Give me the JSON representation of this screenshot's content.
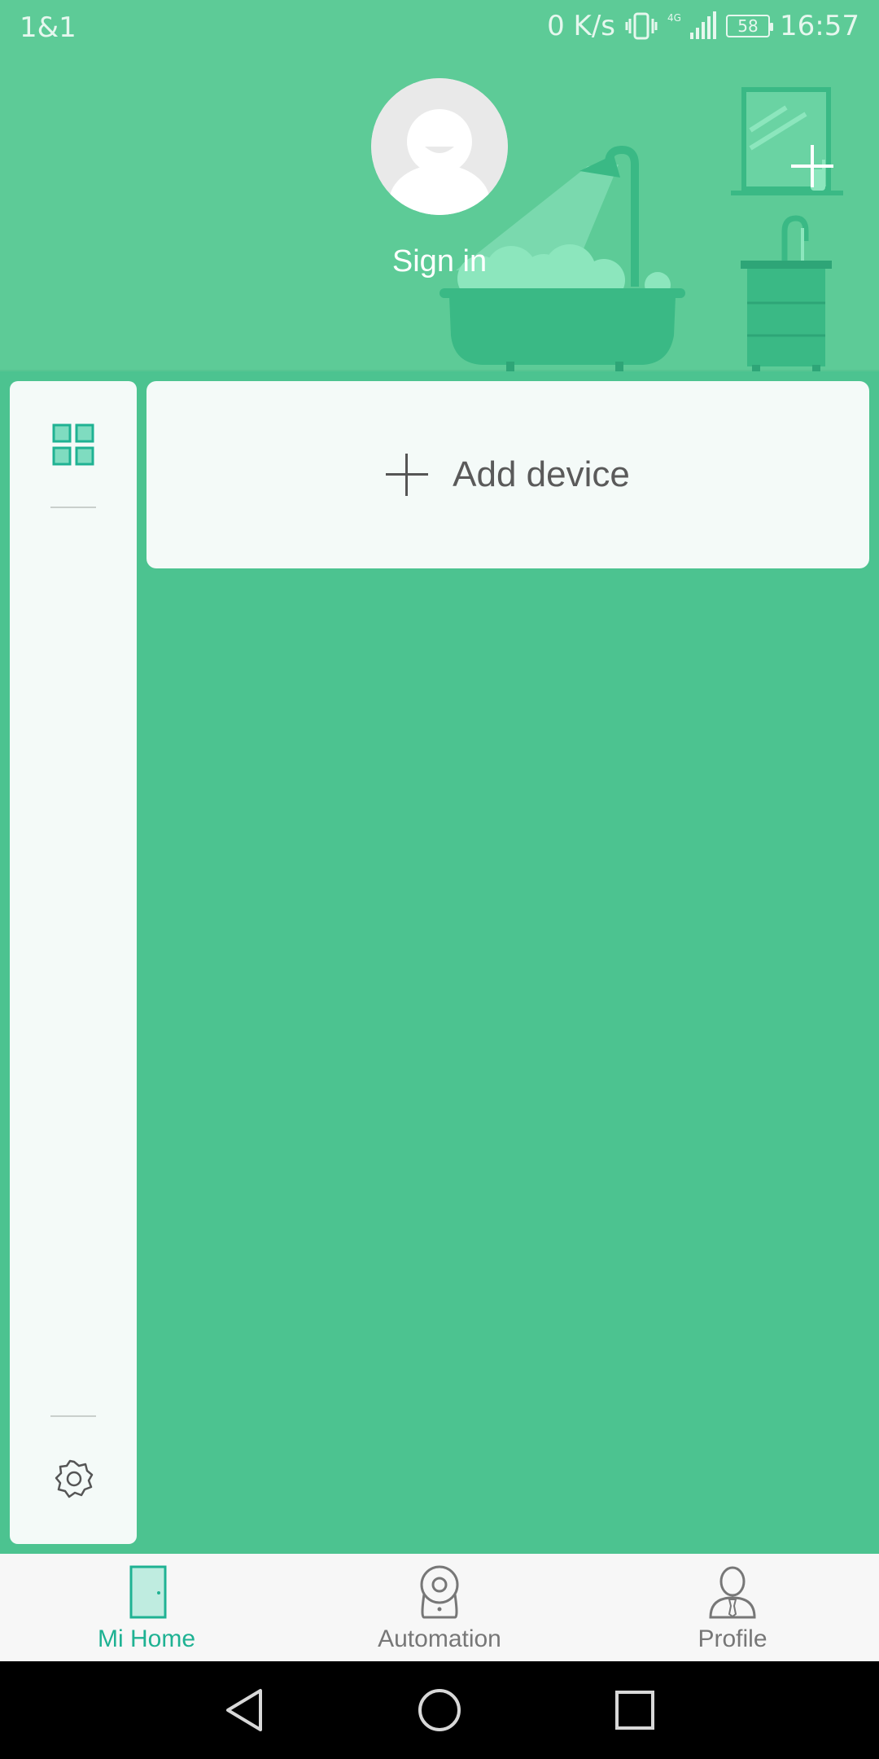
{
  "status_bar": {
    "carrier": "1&1",
    "speed": "0 K/s",
    "network": "4G",
    "battery": "58",
    "time": "16:57"
  },
  "header": {
    "sign_in_label": "Sign in"
  },
  "main": {
    "add_device_label": "Add device"
  },
  "bottom_nav": {
    "items": [
      {
        "label": "Mi Home",
        "icon": "door-icon",
        "active": true
      },
      {
        "label": "Automation",
        "icon": "camera-icon",
        "active": false
      },
      {
        "label": "Profile",
        "icon": "person-icon",
        "active": false
      }
    ]
  },
  "system_nav": {
    "back": "back-icon",
    "home": "home-icon",
    "recents": "recents-icon"
  },
  "colors": {
    "background": "#4cc390",
    "header": "#5dcb97",
    "accent": "#1fb293",
    "card": "#f4faf8"
  }
}
